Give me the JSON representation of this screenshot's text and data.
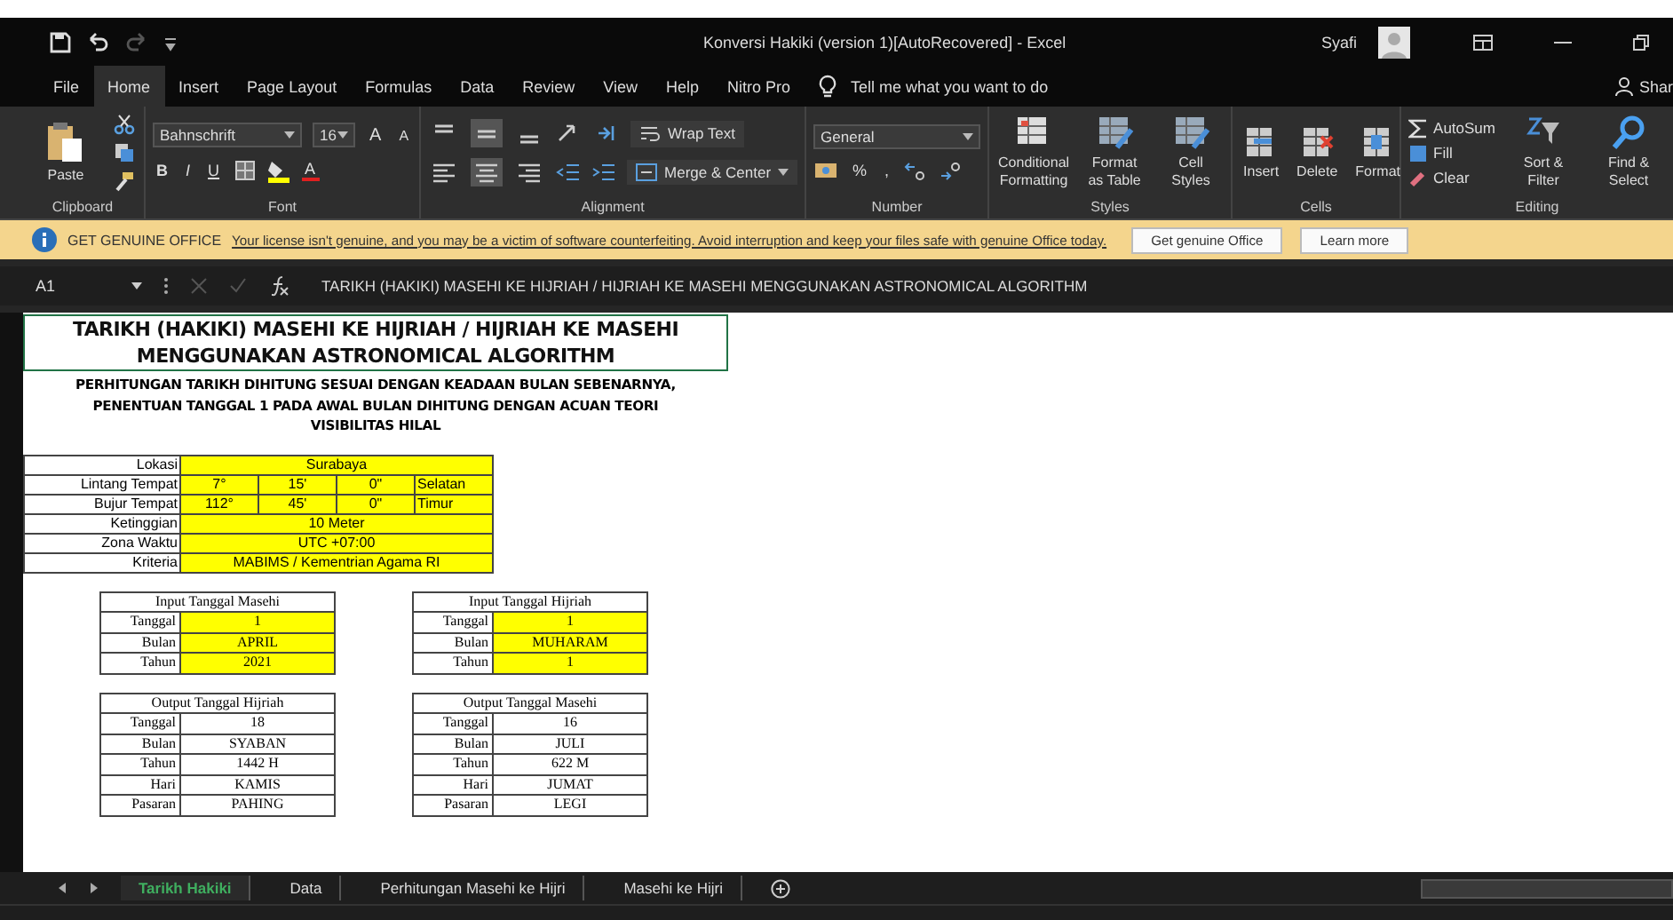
{
  "window": {
    "title": "Konversi Hakiki (version 1)[AutoRecovered]  -  Excel",
    "user": "Syafi"
  },
  "menu_tabs": [
    {
      "label": "File",
      "selected": false
    },
    {
      "label": "Home",
      "selected": true
    },
    {
      "label": "Insert",
      "selected": false
    },
    {
      "label": "Page Layout",
      "selected": false
    },
    {
      "label": "Formulas",
      "selected": false
    },
    {
      "label": "Data",
      "selected": false
    },
    {
      "label": "Review",
      "selected": false
    },
    {
      "label": "View",
      "selected": false
    },
    {
      "label": "Help",
      "selected": false
    },
    {
      "label": "Nitro Pro",
      "selected": false
    }
  ],
  "tell_me": {
    "placeholder": "Tell me what you want to do"
  },
  "share": "Shar",
  "ribbon": {
    "clipboard": {
      "paste": "Paste",
      "label": "Clipboard"
    },
    "font": {
      "family": "Bahnschrift",
      "size": "16",
      "grow": "A",
      "shrink": "A",
      "styles": [
        "B",
        "I",
        "U"
      ],
      "font_color": "A",
      "label": "Font"
    },
    "alignment": {
      "valign": [
        {
          "selected": false
        },
        {
          "selected": true
        },
        {
          "selected": false
        }
      ],
      "halign": [
        {
          "selected": false
        },
        {
          "selected": true
        },
        {
          "selected": false
        }
      ],
      "wrap": "Wrap Text",
      "merge": "Merge & Center",
      "label": "Alignment"
    },
    "number": {
      "format": "General",
      "percent": "%",
      "comma": ",",
      "label": "Number"
    },
    "styles": {
      "buttons": [
        "Conditional Formatting",
        "Format as Table",
        "Cell Styles"
      ],
      "label": "Styles"
    },
    "cells": {
      "buttons": [
        "Insert",
        "Delete",
        "Format"
      ],
      "label": "Cells"
    },
    "editing": {
      "small": [
        "AutoSum",
        "Fill",
        "Clear"
      ],
      "buttons": [
        "Sort & Filter",
        "Find & Select"
      ],
      "label": "Editing"
    }
  },
  "notice": {
    "title": "GET GENUINE OFFICE",
    "message": "Your license isn't genuine, and you may be a victim of software counterfeiting. Avoid interruption and keep your files safe with genuine Office today.",
    "buttons": [
      "Get genuine Office",
      "Learn more"
    ]
  },
  "formula_bar": {
    "name_box": "A1",
    "formula": "TARIKH (HAKIKI) MASEHI KE HIJRIAH / HIJRIAH KE MASEHI MENGGUNAKAN ASTRONOMICAL ALGORITHM"
  },
  "sheet": {
    "title": [
      "TARIKH (HAKIKI) MASEHI KE HIJRIAH / HIJRIAH KE MASEHI",
      "MENGGUNAKAN ASTRONOMICAL ALGORITHM"
    ],
    "subtitle": "PERHITUNGAN TARIKH DIHITUNG SESUAI DENGAN KEADAAN BULAN SEBENARNYA, PENENTUAN TANGGAL 1 PADA AWAL BULAN DIHITUNG DENGAN ACUAN TEORI VISIBILITAS HILAL",
    "location": [
      {
        "label": "Lokasi",
        "values": [
          "Surabaya"
        ]
      },
      {
        "label": "Lintang Tempat",
        "values": [
          "7°",
          "15'",
          "0\"",
          "Selatan"
        ]
      },
      {
        "label": "Bujur Tempat",
        "values": [
          "112°",
          "45'",
          "0\"",
          "Timur"
        ]
      },
      {
        "label": "Ketinggian",
        "values": [
          "10 Meter"
        ]
      },
      {
        "label": "Zona Waktu",
        "values": [
          "UTC +07:00"
        ]
      },
      {
        "label": "Kriteria",
        "values": [
          "MABIMS / Kementrian Agama RI"
        ]
      }
    ],
    "tables": [
      {
        "title": "Input Tanggal Masehi",
        "input": true,
        "rows": [
          {
            "label": "Tanggal",
            "value": "1"
          },
          {
            "label": "Bulan",
            "value": "APRIL"
          },
          {
            "label": "Tahun",
            "value": "2021"
          }
        ]
      },
      {
        "title": "Input Tanggal Hijriah",
        "input": true,
        "rows": [
          {
            "label": "Tanggal",
            "value": "1"
          },
          {
            "label": "Bulan",
            "value": "MUHARAM"
          },
          {
            "label": "Tahun",
            "value": "1"
          }
        ]
      },
      {
        "title": "Output Tanggal Hijriah",
        "input": false,
        "rows": [
          {
            "label": "Tanggal",
            "value": "18"
          },
          {
            "label": "Bulan",
            "value": "SYABAN"
          },
          {
            "label": "Tahun",
            "value": "1442 H"
          },
          {
            "label": "Hari",
            "value": "KAMIS"
          },
          {
            "label": "Pasaran",
            "value": "PAHING"
          }
        ]
      },
      {
        "title": "Output Tanggal Masehi",
        "input": false,
        "rows": [
          {
            "label": "Tanggal",
            "value": "16"
          },
          {
            "label": "Bulan",
            "value": "JULI"
          },
          {
            "label": "Tahun",
            "value": "622 M"
          },
          {
            "label": "Hari",
            "value": "JUMAT"
          },
          {
            "label": "Pasaran",
            "value": "LEGI"
          }
        ]
      }
    ]
  },
  "sheet_tabs": [
    {
      "label": "Tarikh Hakiki",
      "selected": true
    },
    {
      "label": "Data",
      "selected": false
    },
    {
      "label": "Perhitungan Masehi ke Hijri",
      "selected": false
    },
    {
      "label": "Masehi ke Hijri",
      "selected": false
    }
  ]
}
